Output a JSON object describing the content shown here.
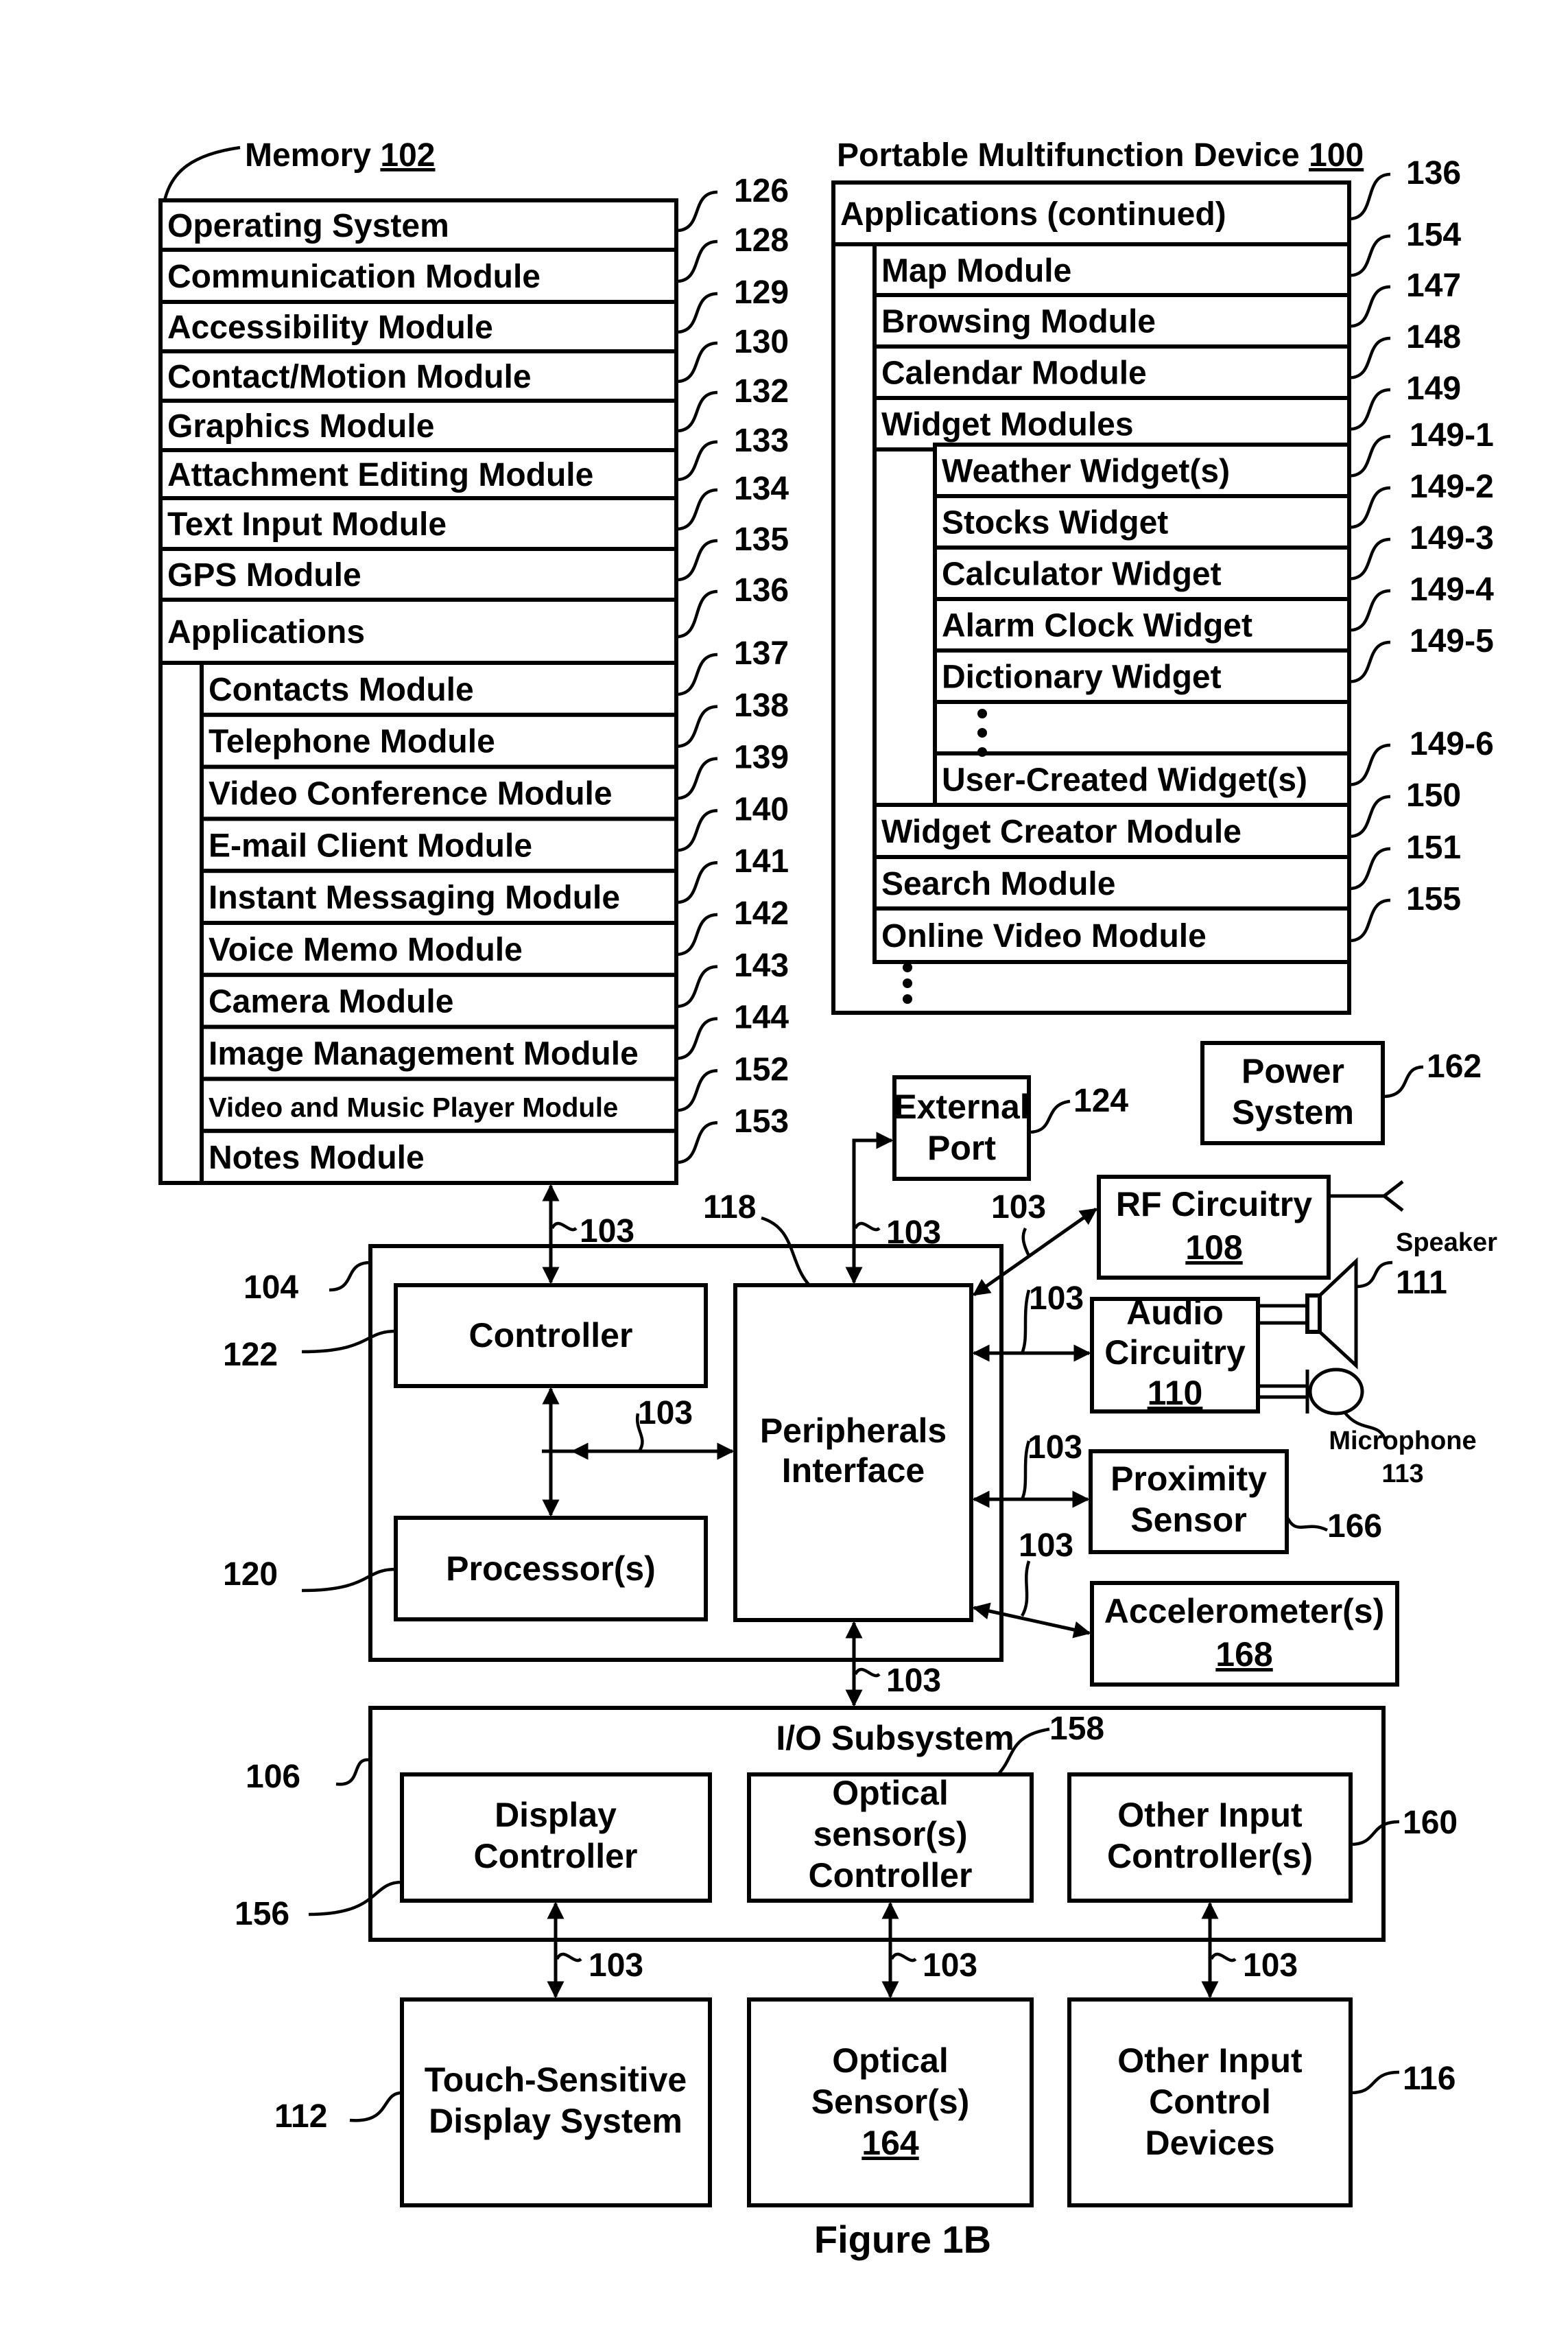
{
  "memory": {
    "title": "Memory",
    "ref": "102",
    "modules": [
      {
        "label": "Operating System",
        "ref": "126"
      },
      {
        "label": "Communication Module",
        "ref": "128"
      },
      {
        "label": "Accessibility Module",
        "ref": "129"
      },
      {
        "label": "Contact/Motion Module",
        "ref": "130"
      },
      {
        "label": "Graphics Module",
        "ref": "132"
      },
      {
        "label": "Attachment Editing Module",
        "ref": "133"
      },
      {
        "label": "Text Input Module",
        "ref": "134"
      },
      {
        "label": "GPS Module",
        "ref": "135"
      }
    ],
    "applications": {
      "label": "Applications",
      "ref": "136",
      "items": [
        {
          "label": "Contacts Module",
          "ref": "137"
        },
        {
          "label": "Telephone Module",
          "ref": "138"
        },
        {
          "label": "Video Conference Module",
          "ref": "139"
        },
        {
          "label": "E-mail Client Module",
          "ref": "140"
        },
        {
          "label": "Instant Messaging Module",
          "ref": "141"
        },
        {
          "label": "Voice Memo Module",
          "ref": "142"
        },
        {
          "label": "Camera Module",
          "ref": "143"
        },
        {
          "label": "Image Management Module",
          "ref": "144"
        },
        {
          "label": "Video and Music Player Module",
          "ref": "152"
        },
        {
          "label": "Notes Module",
          "ref": "153"
        }
      ]
    }
  },
  "device": {
    "title": "Portable Multifunction Device",
    "ref": "100",
    "applications_continued": {
      "label": "Applications (continued)",
      "ref": "136",
      "items": [
        {
          "label": "Map Module",
          "ref": "154"
        },
        {
          "label": "Browsing Module",
          "ref": "147"
        },
        {
          "label": "Calendar Module",
          "ref": "148"
        },
        {
          "label": "Widget Modules",
          "ref": "149"
        }
      ],
      "widgets": [
        {
          "label": "Weather Widget(s)",
          "ref": "149-1"
        },
        {
          "label": "Stocks Widget",
          "ref": "149-2"
        },
        {
          "label": "Calculator Widget",
          "ref": "149-3"
        },
        {
          "label": "Alarm Clock Widget",
          "ref": "149-4"
        },
        {
          "label": "Dictionary Widget",
          "ref": "149-5"
        },
        {
          "label": "User-Created Widget(s)",
          "ref": "149-6"
        }
      ],
      "after": [
        {
          "label": "Widget Creator Module",
          "ref": "150"
        },
        {
          "label": "Search Module",
          "ref": "151"
        },
        {
          "label": "Online Video Module",
          "ref": "155"
        }
      ]
    }
  },
  "bus_ref": "103",
  "blocks": {
    "external_port": {
      "lines": [
        "External",
        "Port"
      ],
      "ref": "124"
    },
    "power_system": {
      "lines": [
        "Power",
        "System"
      ],
      "ref": "162"
    },
    "rf_circuitry": {
      "lines": [
        "RF Circuitry"
      ],
      "num": "108"
    },
    "audio_circuitry": {
      "lines": [
        "Audio",
        "Circuitry"
      ],
      "num": "110"
    },
    "speaker": {
      "label": "Speaker",
      "ref": "111"
    },
    "microphone": {
      "label": "Microphone",
      "ref": "113"
    },
    "proximity_sensor": {
      "lines": [
        "Proximity",
        "Sensor"
      ],
      "ref": "166"
    },
    "accelerometer": {
      "lines": [
        "Accelerometer(s)"
      ],
      "num": "168"
    },
    "chip": {
      "ref": "104"
    },
    "controller": {
      "label": "Controller",
      "ref": "122"
    },
    "processor": {
      "label": "Processor(s)",
      "ref": "120"
    },
    "peripherals": {
      "lines": [
        "Peripherals",
        "Interface"
      ],
      "ref": "118"
    },
    "io_subsystem": {
      "label": "I/O Subsystem",
      "ref": "106"
    },
    "display_controller": {
      "lines": [
        "Display",
        "Controller"
      ],
      "ref": "156"
    },
    "optical_controller": {
      "lines": [
        "Optical",
        "sensor(s)",
        "Controller"
      ],
      "ref": "158"
    },
    "other_input_controller": {
      "lines": [
        "Other Input",
        "Controller(s)"
      ],
      "ref": "160"
    },
    "touch_display": {
      "lines": [
        "Touch-Sensitive",
        "Display System"
      ],
      "ref": "112"
    },
    "optical_sensor": {
      "lines": [
        "Optical",
        "Sensor(s)"
      ],
      "num": "164"
    },
    "other_input_devices": {
      "lines": [
        "Other Input",
        "Control",
        "Devices"
      ],
      "ref": "116"
    }
  },
  "figure_caption": "Figure 1B"
}
